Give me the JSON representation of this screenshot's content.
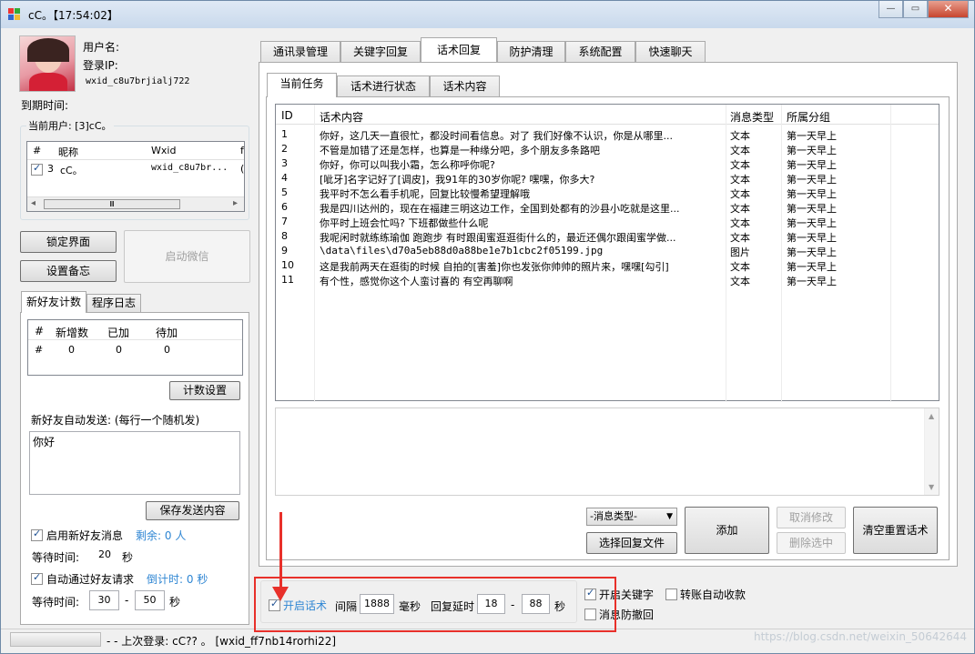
{
  "window": {
    "title": "cC。【17:54:02】",
    "minimize": "—",
    "maximize": "▭",
    "close": "✕"
  },
  "profile": {
    "username_label": "用户名:",
    "login_ip_label": "登录IP:",
    "wxid": "wxid_c8u7brjialj722",
    "expire_label": "到期时间:"
  },
  "current_user": {
    "group_label": "当前用户: [3]cC。",
    "columns": [
      "#",
      "昵称",
      "Wxid",
      "f"
    ],
    "row": {
      "num": "3",
      "nick": "cC。",
      "wxid": "wxid_c8u7br...",
      "extra": "("
    },
    "scroll_glyph": "Ⅲ",
    "scroll_left": "◂",
    "scroll_right": "▸"
  },
  "left_buttons": {
    "lock": "锁定界面",
    "memo": "设置备忘",
    "start_wechat": "启动微信"
  },
  "left_tabs": [
    "新好友计数",
    "程序日志"
  ],
  "count_table": {
    "columns": [
      "#",
      "新增数",
      "已加",
      "待加"
    ],
    "row": [
      "#",
      "0",
      "0",
      "0"
    ],
    "settings_btn": "计数设置"
  },
  "auto_send": {
    "label": "新好友自动发送: (每行一个随机发)",
    "text": "你好",
    "save_btn": "保存发送内容"
  },
  "new_friend": {
    "enable_label": "启用新好友消息",
    "remain": "剩余: 0 人",
    "wait_label": "等待时间:",
    "wait_value": "20",
    "sec": "秒"
  },
  "auto_pass": {
    "label": "自动通过好友请求",
    "countdown": "倒计时: 0 秒",
    "wait_label": "等待时间:",
    "from": "30",
    "to": "50",
    "dash": "-",
    "sec": "秒"
  },
  "status": {
    "text": "- - 上次登录: cC?? 。 [wxid_ff7nb14rorhi22]"
  },
  "main_tabs": [
    "通讯录管理",
    "关键字回复",
    "话术回复",
    "防护清理",
    "系统配置",
    "快速聊天"
  ],
  "sub_tabs": [
    "当前任务",
    "话术进行状态",
    "话术内容"
  ],
  "table": {
    "columns": [
      "ID",
      "话术内容",
      "消息类型",
      "所属分组"
    ],
    "rows": [
      [
        "1",
        "你好，这几天一直很忙，都没时间看信息。对了 我们好像不认识，你是从哪里...",
        "文本",
        "第一天早上"
      ],
      [
        "2",
        "不管是加错了还是怎样，也算是一种缘分吧，多个朋友多条路吧",
        "文本",
        "第一天早上"
      ],
      [
        "3",
        "你好，你可以叫我小霜，怎么称呼你呢?",
        "文本",
        "第一天早上"
      ],
      [
        "4",
        "[呲牙]名字记好了[调皮]，我91年的30岁你呢? 嘿嘿，你多大?",
        "文本",
        "第一天早上"
      ],
      [
        "5",
        "我平时不怎么看手机呢，回复比较慢希望理解哦",
        "文本",
        "第一天早上"
      ],
      [
        "6",
        "我是四川达州的，现在在福建三明这边工作，全国到处都有的沙县小吃就是这里...",
        "文本",
        "第一天早上"
      ],
      [
        "7",
        "你平时上班会忙吗? 下班都做些什么呢",
        "文本",
        "第一天早上"
      ],
      [
        "8",
        "我呢闲时就练练瑜伽 跑跑步 有时跟闺蜜逛逛街什么的，最近还偶尔跟闺蜜学做...",
        "文本",
        "第一天早上"
      ],
      [
        "9",
        "\\data\\files\\d70a5eb88d0a88be1e7b1cbc2f05199.jpg",
        "图片",
        "第一天早上"
      ],
      [
        "10",
        "这是我前两天在逛街的时候 自拍的[害羞]你也发张你帅帅的照片来，嘿嘿[勾引]",
        "文本",
        "第一天早上"
      ],
      [
        "11",
        "有个性，感觉你这个人蛮讨喜的 有空再聊啊",
        "文本",
        "第一天早上"
      ]
    ]
  },
  "controls": {
    "msg_type": "-消息类型-",
    "select_file": "选择回复文件",
    "add": "添加",
    "cancel_edit": "取消修改",
    "delete_sel": "删除选中",
    "clear_reset": "清空重置话术"
  },
  "bottom": {
    "enable_script": "开启话术",
    "interval_label": "间隔",
    "interval_value": "1888",
    "ms": "毫秒",
    "reply_delay": "回复延时",
    "delay_from": "18",
    "dash": "-",
    "delay_to": "88",
    "sec": "秒",
    "enable_keyword": "开启关键字",
    "transfer_collect": "转账自动收款",
    "anti_recall": "消息防撤回"
  },
  "watermark": "https://blog.csdn.net/weixin_50642644",
  "colors": {
    "highlight_red": "#e8302a",
    "accent_blue": "#2f86d3"
  }
}
